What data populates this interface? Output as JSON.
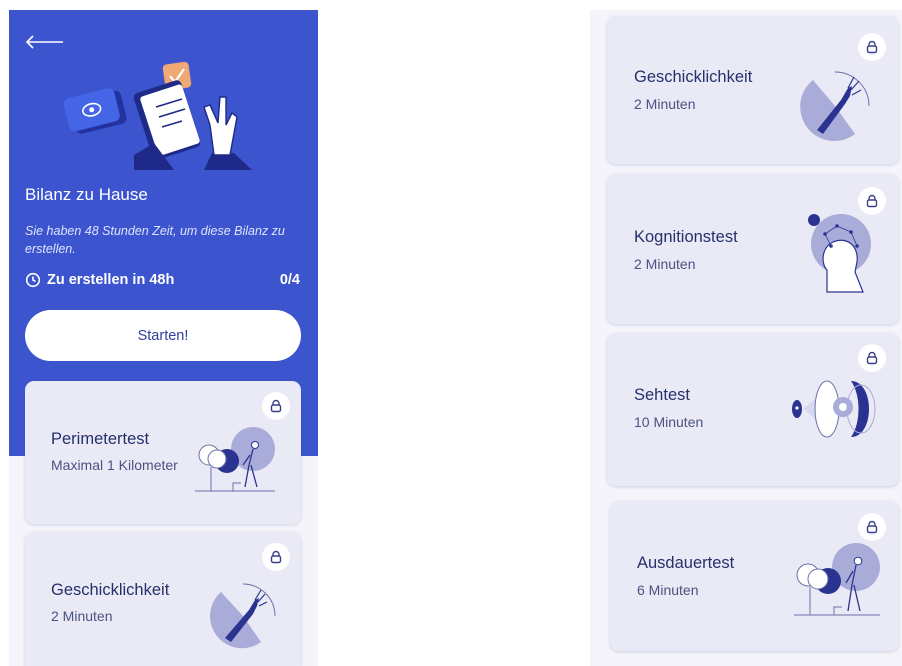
{
  "left_screen": {
    "back_icon": "arrow-left-icon",
    "header_illustration": "checklist-illustration",
    "title": "Bilanz zu Hause",
    "subtitle": "Sie haben 48 Stunden Zeit, um diese Bilanz zu erstellen.",
    "timer_icon": "clock-icon",
    "timer_label": "Zu erstellen in 48h",
    "progress": "0/4",
    "start_button": "Starten!",
    "cards": [
      {
        "name": "Perimetertest",
        "duration": "Maximal 1 Kilometer",
        "icon": "lock-icon",
        "illustration": "walking-person-tree"
      },
      {
        "name": "Geschicklichkeit",
        "duration": "2 Minuten",
        "icon": "lock-icon",
        "illustration": "hand-dexterity"
      }
    ]
  },
  "right_screen": {
    "cards": [
      {
        "name": "Geschicklichkeit",
        "duration": "2 Minuten",
        "icon": "lock-icon",
        "illustration": "hand-dexterity"
      },
      {
        "name": "Kognitionstest",
        "duration": "2 Minuten",
        "icon": "lock-icon",
        "illustration": "head-constellation"
      },
      {
        "name": "Sehtest",
        "duration": "10 Minuten",
        "icon": "lock-icon",
        "illustration": "eye-vision"
      },
      {
        "name": "Ausdauertest",
        "duration": "6 Minuten",
        "icon": "lock-icon",
        "illustration": "walking-person-tree"
      }
    ]
  },
  "colors": {
    "primary": "#3c55cf",
    "card": "#eaeaf7",
    "text_dark": "#27306a",
    "accent_orange": "#f0a874"
  }
}
